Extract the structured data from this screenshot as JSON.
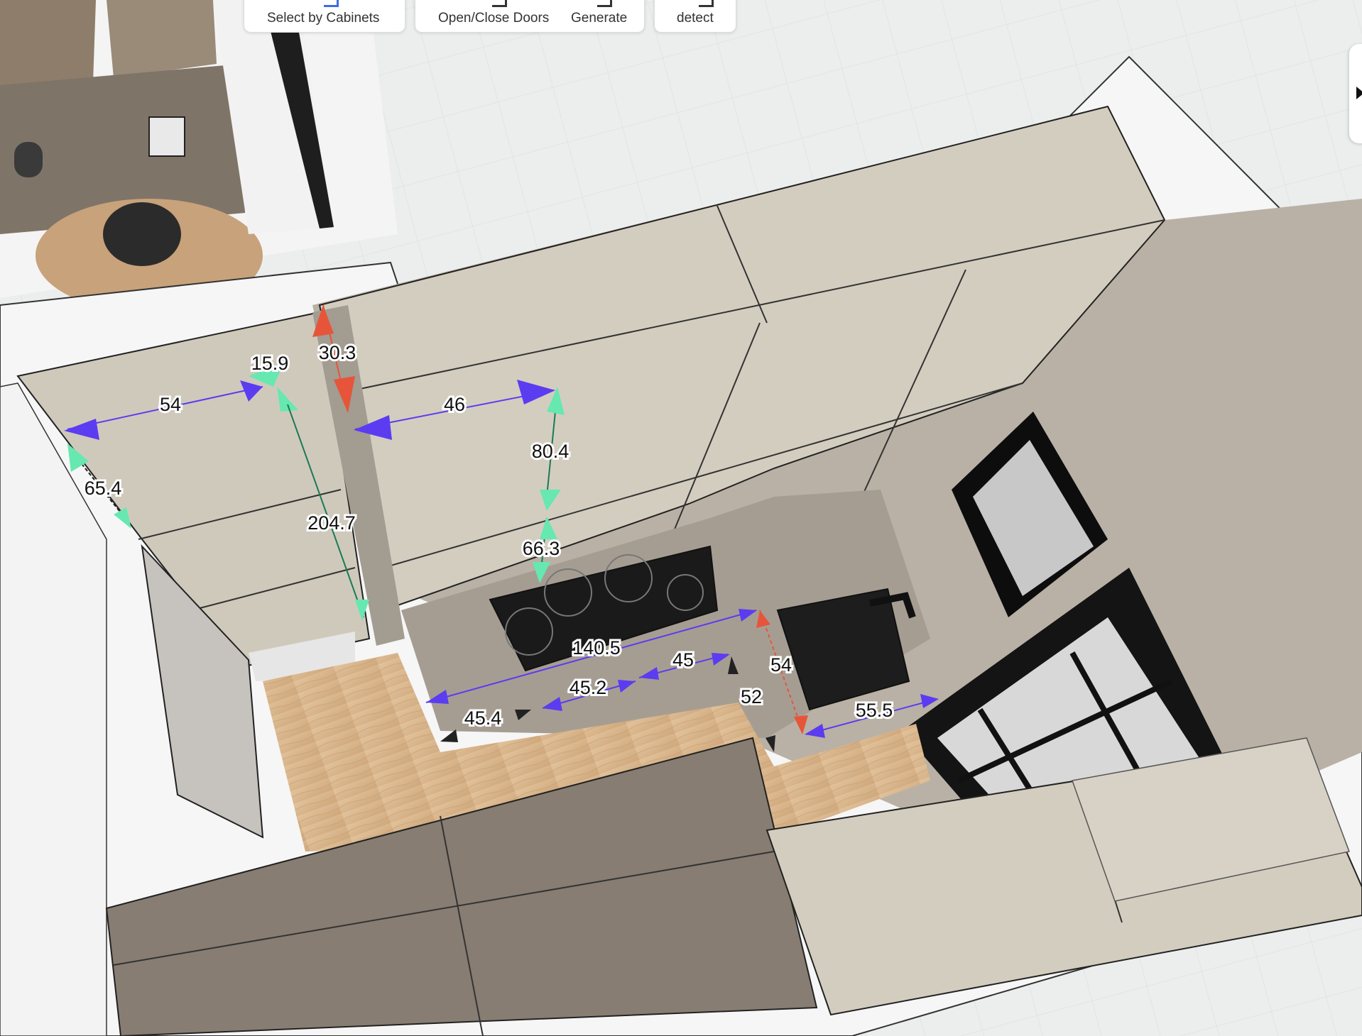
{
  "toolbar": {
    "select_by_cabinets": "Select by Cabinets",
    "open_close_doors": "Open/Close Doors",
    "generate": "Generate",
    "detect": "detect"
  },
  "dimensions": {
    "upper_left_width": "54",
    "upper_left_gap": "15.9",
    "upper_left_depth": "65.4",
    "tall_height": "204.7",
    "upper_top_gap": "30.3",
    "upper_width": "46",
    "upper_height": "80.4",
    "upper_to_counter": "66.3",
    "counter_length": "140.5",
    "base_width_45": "45",
    "base_width_45_2": "45.2",
    "base_width_45_4": "45.4",
    "sink_depth": "54",
    "base_depth": "52",
    "sink_width": "55.5"
  },
  "colors": {
    "blue_arrow": "#5b3cf0",
    "green_arrow": "#66e8b0",
    "red_arrow": "#e6553a",
    "cabinet_light": "#d3cdc0",
    "cabinet_dark": "#8a8075",
    "floor_wood": "#d8b68e"
  },
  "icons": {
    "panel_toggle": "caret-right-icon"
  }
}
